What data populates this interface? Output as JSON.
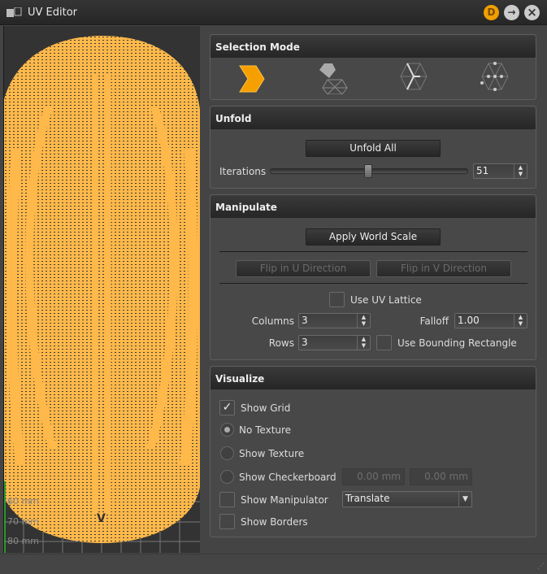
{
  "window": {
    "title": "UV Editor",
    "buttons": {
      "dock": "D",
      "float": "→",
      "close": "×"
    }
  },
  "viewport": {
    "grid_labels": [
      "-60 mm",
      "-70 mm",
      "-80 mm"
    ],
    "uv_label": "V",
    "mesh_color": "#FFB84A"
  },
  "selection_mode": {
    "title": "Selection Mode",
    "modes": [
      "face-mode",
      "shell-mode",
      "edge-mode",
      "vertex-mode"
    ],
    "active": "face-mode"
  },
  "unfold": {
    "title": "Unfold",
    "unfold_all": "Unfold All",
    "iterations_label": "Iterations",
    "iterations_value": "51",
    "iterations_slider_percent": 50
  },
  "manipulate": {
    "title": "Manipulate",
    "apply_world_scale": "Apply World Scale",
    "flip_u": "Flip in U Direction",
    "flip_v": "Flip in V Direction",
    "use_uv_lattice": "Use UV Lattice",
    "columns_label": "Columns",
    "columns_value": "3",
    "rows_label": "Rows",
    "rows_value": "3",
    "falloff_label": "Falloff",
    "falloff_value": "1.00",
    "use_bounding_rectangle": "Use Bounding Rectangle"
  },
  "visualize": {
    "title": "Visualize",
    "show_grid": "Show Grid",
    "no_texture": "No Texture",
    "show_texture": "Show Texture",
    "show_checkerboard": "Show Checkerboard",
    "checker_u": "0.00 mm",
    "checker_v": "0.00 mm",
    "show_manipulator": "Show Manipulator",
    "manipulator_mode": "Translate",
    "show_borders": "Show Borders"
  }
}
